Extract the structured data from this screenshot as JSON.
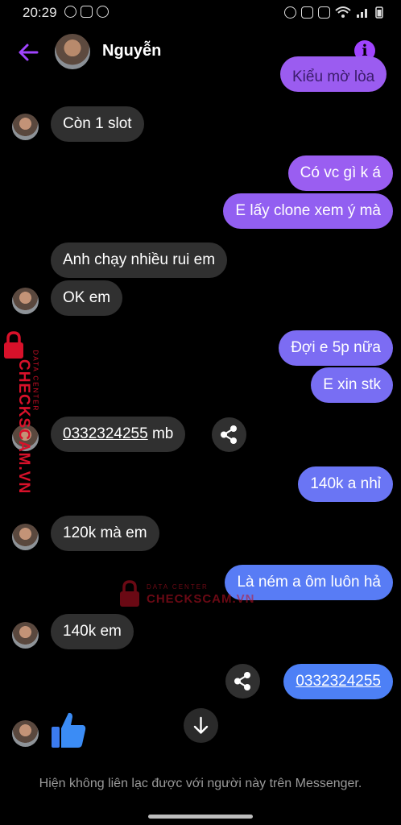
{
  "status_bar": {
    "time": "20:29",
    "battery_icon": "battery-icon",
    "signal_icon": "signal-icon",
    "wifi_icon": "wifi-icon"
  },
  "header": {
    "contact_name": "Nguyễn",
    "back_icon": "back-arrow-icon",
    "info_icon": "info-icon"
  },
  "colors": {
    "accent": "#a044ff",
    "out_bubble_top": "#9b5cf0",
    "out_bubble_bottom": "#4d7ff6",
    "in_bubble": "#303030"
  },
  "messages": [
    {
      "dir": "out",
      "text": "Kiểu mờ lòa",
      "partial": true
    },
    {
      "dir": "in",
      "text": "Còn 1 slot"
    },
    {
      "dir": "out",
      "text": "Có vc gì k á"
    },
    {
      "dir": "out",
      "text": "E lấy clone xem ý mà"
    },
    {
      "dir": "in",
      "text": "Anh chạy nhiều rui em"
    },
    {
      "dir": "in",
      "text": "OK em"
    },
    {
      "dir": "out",
      "text": "Đợi e 5p nữa"
    },
    {
      "dir": "out",
      "text": "E xin stk"
    },
    {
      "dir": "in",
      "link": "0332324255",
      "suffix": " mb"
    },
    {
      "dir": "out",
      "text": "140k a nhỉ"
    },
    {
      "dir": "in",
      "text": "120k mà em"
    },
    {
      "dir": "out",
      "text": "Là ném a ôm luôn hả"
    },
    {
      "dir": "in",
      "text": "140k em"
    },
    {
      "dir": "out",
      "link": "0332324255"
    },
    {
      "dir": "in",
      "icon": "thumbs-up-icon"
    }
  ],
  "footer": {
    "notice": "Hiện không liên lạc được với người này trên Messenger."
  },
  "watermark": {
    "brand": "CHECKSCAM.VN",
    "sub": "DATA CENTER"
  }
}
